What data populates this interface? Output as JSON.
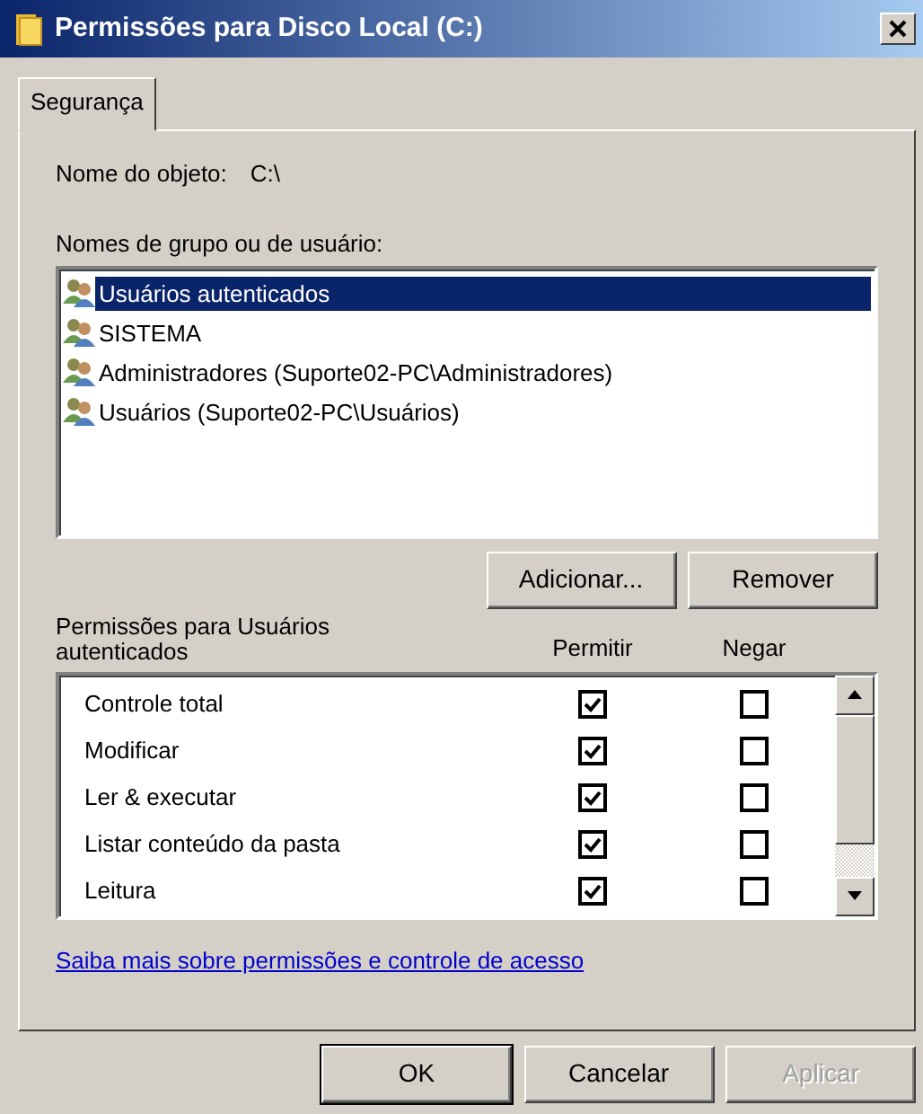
{
  "window": {
    "title": "Permissões para Disco Local (C:)"
  },
  "tabs": [
    {
      "label": "Segurança",
      "selected": true
    }
  ],
  "object_name": {
    "label": "Nome do objeto:",
    "value": "C:\\"
  },
  "groups": {
    "label": "Nomes de grupo ou de usuário:",
    "items": [
      {
        "name": "Usuários autenticados",
        "selected": true
      },
      {
        "name": "SISTEMA",
        "selected": false
      },
      {
        "name": "Administradores (Suporte02-PC\\Administradores)",
        "selected": false
      },
      {
        "name": "Usuários (Suporte02-PC\\Usuários)",
        "selected": false
      }
    ]
  },
  "group_buttons": [
    {
      "label": "Adicionar..."
    },
    {
      "label": "Remover"
    }
  ],
  "permissions": {
    "label": "Permissões para Usuários autenticados",
    "columns": [
      "Permitir",
      "Negar"
    ],
    "rows": [
      {
        "name": "Controle total",
        "allow": true,
        "deny": false
      },
      {
        "name": "Modificar",
        "allow": true,
        "deny": false
      },
      {
        "name": "Ler & executar",
        "allow": true,
        "deny": false
      },
      {
        "name": "Listar conteúdo da pasta",
        "allow": true,
        "deny": false
      },
      {
        "name": "Leitura",
        "allow": true,
        "deny": false
      }
    ]
  },
  "link": "Saiba mais sobre permissões e controle de acesso",
  "dialog_buttons": [
    {
      "label": "OK",
      "disabled": false
    },
    {
      "label": "Cancelar",
      "disabled": false
    },
    {
      "label": "Aplicar",
      "disabled": true
    }
  ]
}
